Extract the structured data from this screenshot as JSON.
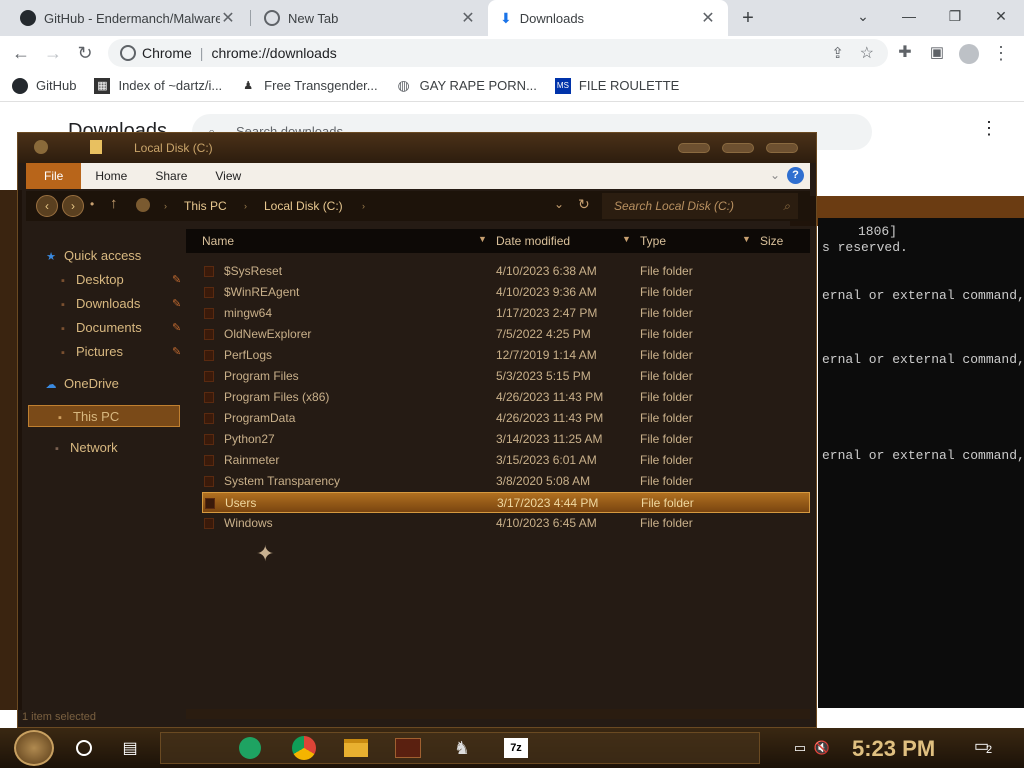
{
  "browser": {
    "tabs": [
      {
        "title": "GitHub - Endermanch/Malware",
        "active": false
      },
      {
        "title": "New Tab",
        "active": false
      },
      {
        "title": "Downloads",
        "active": true
      }
    ],
    "omnibox": {
      "site_chip": "Chrome",
      "url": "chrome://downloads"
    },
    "bookmarks": [
      {
        "label": "GitHub",
        "icon": "github-icon"
      },
      {
        "label": "Index of ~dartz/i...",
        "icon": "qr-icon"
      },
      {
        "label": "Free Transgender...",
        "icon": "figure-icon"
      },
      {
        "label": "GAY RAPE PORN...",
        "icon": "globe-icon"
      },
      {
        "label": "FILE ROULETTE",
        "icon": "msdos-icon"
      }
    ]
  },
  "downloads_page": {
    "title": "Downloads",
    "search_placeholder": "Search downloads"
  },
  "cmd": {
    "lines": [
      "1806]",
      "s reserved.",
      "ernal or external command,",
      "ernal or external command,",
      "ernal or external command,"
    ]
  },
  "explorer": {
    "title": "Local Disk (C:)",
    "ribbon_tabs": [
      "File",
      "Home",
      "Share",
      "View"
    ],
    "help_label": "?",
    "breadcrumb": [
      "This PC",
      "Local Disk (C:)"
    ],
    "search_placeholder": "Search Local Disk (C:)",
    "nav": {
      "quick_access": "Quick access",
      "desktop": "Desktop",
      "downloads": "Downloads",
      "documents": "Documents",
      "pictures": "Pictures",
      "onedrive": "OneDrive",
      "this_pc": "This PC",
      "network": "Network"
    },
    "columns": {
      "name": "Name",
      "date": "Date modified",
      "type": "Type",
      "size": "Size"
    },
    "files": [
      {
        "name": "$SysReset",
        "date": "4/10/2023 6:38 AM",
        "type": "File folder"
      },
      {
        "name": "$WinREAgent",
        "date": "4/10/2023 9:36 AM",
        "type": "File folder"
      },
      {
        "name": "mingw64",
        "date": "1/17/2023 2:47 PM",
        "type": "File folder"
      },
      {
        "name": "OldNewExplorer",
        "date": "7/5/2022 4:25 PM",
        "type": "File folder"
      },
      {
        "name": "PerfLogs",
        "date": "12/7/2019 1:14 AM",
        "type": "File folder"
      },
      {
        "name": "Program Files",
        "date": "5/3/2023 5:15 PM",
        "type": "File folder"
      },
      {
        "name": "Program Files (x86)",
        "date": "4/26/2023 11:43 PM",
        "type": "File folder"
      },
      {
        "name": "ProgramData",
        "date": "4/26/2023 11:43 PM",
        "type": "File folder"
      },
      {
        "name": "Python27",
        "date": "3/14/2023 11:25 AM",
        "type": "File folder"
      },
      {
        "name": "Rainmeter",
        "date": "3/15/2023 6:01 AM",
        "type": "File folder"
      },
      {
        "name": "System Transparency",
        "date": "3/8/2020 5:08 AM",
        "type": "File folder"
      },
      {
        "name": "Users",
        "date": "3/17/2023 4:44 PM",
        "type": "File folder",
        "selected": true
      },
      {
        "name": "Windows",
        "date": "4/10/2023 6:45 AM",
        "type": "File folder"
      }
    ],
    "status": "1 item selected"
  },
  "taskbar": {
    "time": "5:23 PM",
    "notification_count": "2",
    "apps": [
      "task-view-icon",
      "sheets-icon",
      "chrome-icon",
      "file-explorer-icon",
      "game-icon",
      "figure-icon",
      "7zip-icon"
    ],
    "sevenzip_label": "7z"
  }
}
